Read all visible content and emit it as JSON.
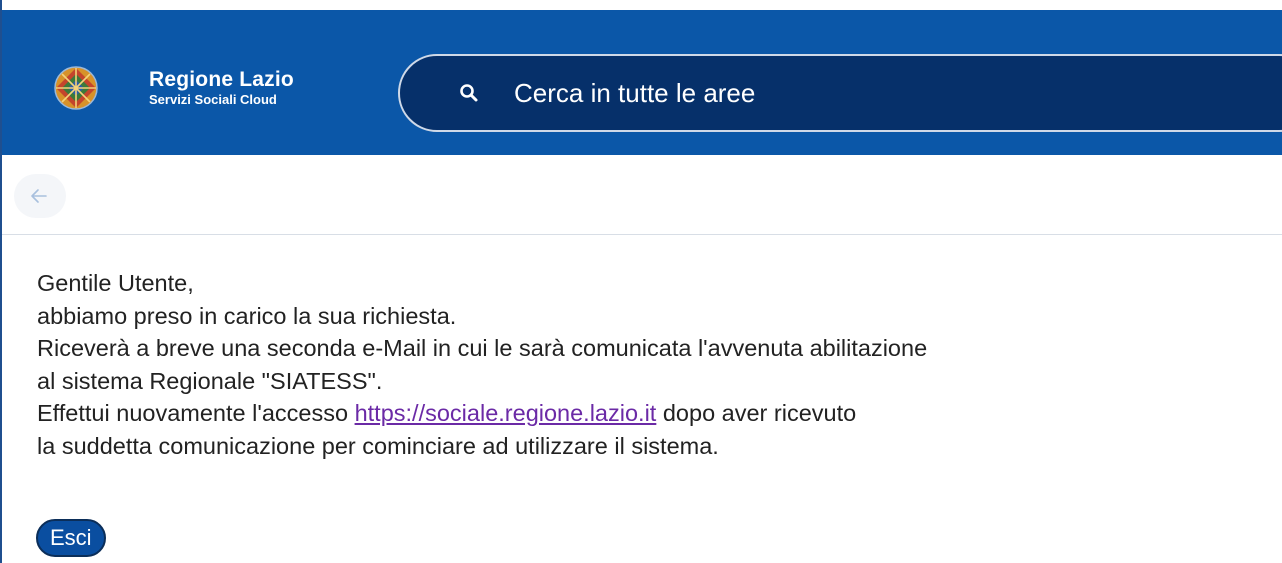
{
  "header": {
    "brand_title": "Regione Lazio",
    "brand_subtitle": "Servizi Sociali Cloud",
    "logo_icon": "regione-lazio-logo-icon",
    "colors": {
      "header_bg": "#0b57a8",
      "search_bg": "#06306a"
    }
  },
  "search": {
    "icon": "search-icon",
    "placeholder": "Cerca in tutte le aree"
  },
  "toolbar": {
    "back_icon": "arrow-left-icon"
  },
  "message": {
    "line1": "Gentile Utente,",
    "line2": "abbiamo preso in carico la sua richiesta.",
    "line3": "Riceverà a breve una seconda e-Mail in cui le sarà comunicata l'avvenuta abilitazione",
    "line4": "al sistema Regionale \"SIATESS\".",
    "line5_before": "Effettui nuovamente l'accesso ",
    "line5_link": "https://sociale.regione.lazio.it",
    "line5_after": " dopo aver ricevuto",
    "line6": "la suddetta comunicazione per cominciare ad utilizzare il sistema."
  },
  "actions": {
    "exit_label": "Esci"
  }
}
